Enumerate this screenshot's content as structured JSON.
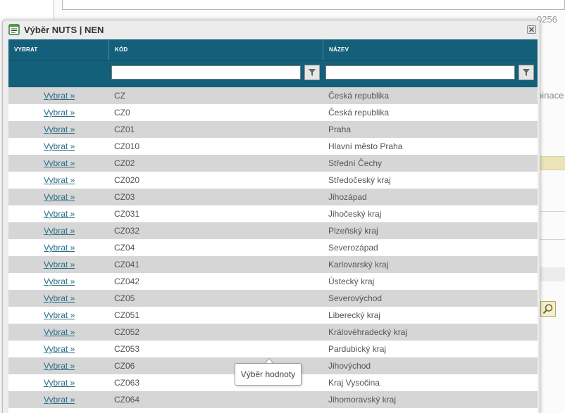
{
  "background": {
    "text_top": "0256",
    "text_side": "binace"
  },
  "dialog": {
    "title": "Výběr NUTS | NEN",
    "columns": [
      "VYBRAT",
      "KÓD",
      "NÁZEV"
    ],
    "filters": {
      "code_value": "",
      "name_value": ""
    },
    "rows": [
      {
        "link": "Vybrat »",
        "code": "CZ",
        "name": "Česká republika"
      },
      {
        "link": "Vybrat »",
        "code": "CZ0",
        "name": "Česká republika"
      },
      {
        "link": "Vybrat »",
        "code": "CZ01",
        "name": "Praha"
      },
      {
        "link": "Vybrat »",
        "code": "CZ010",
        "name": "Hlavní město Praha"
      },
      {
        "link": "Vybrat »",
        "code": "CZ02",
        "name": "Střední Čechy"
      },
      {
        "link": "Vybrat »",
        "code": "CZ020",
        "name": "Středočeský kraj"
      },
      {
        "link": "Vybrat »",
        "code": "CZ03",
        "name": "Jihozápad"
      },
      {
        "link": "Vybrat »",
        "code": "CZ031",
        "name": "Jihočeský kraj"
      },
      {
        "link": "Vybrat »",
        "code": "CZ032",
        "name": "Plzeňský kraj"
      },
      {
        "link": "Vybrat »",
        "code": "CZ04",
        "name": "Severozápad"
      },
      {
        "link": "Vybrat »",
        "code": "CZ041",
        "name": "Karlovarský kraj"
      },
      {
        "link": "Vybrat »",
        "code": "CZ042",
        "name": "Ústecký kraj"
      },
      {
        "link": "Vybrat »",
        "code": "CZ05",
        "name": "Severovýchod"
      },
      {
        "link": "Vybrat »",
        "code": "CZ051",
        "name": "Liberecký kraj"
      },
      {
        "link": "Vybrat »",
        "code": "CZ052",
        "name": "Královéhradecký kraj"
      },
      {
        "link": "Vybrat »",
        "code": "CZ053",
        "name": "Pardubický kraj"
      },
      {
        "link": "Vybrat »",
        "code": "CZ06",
        "name": "Jihovýchod"
      },
      {
        "link": "Vybrat »",
        "code": "CZ063",
        "name": "Kraj Vysočina"
      },
      {
        "link": "Vybrat »",
        "code": "CZ064",
        "name": "Jihomoravský kraj"
      }
    ],
    "tooltip": "Výběr hodnoty"
  },
  "icons": {
    "title": "list-window-icon",
    "close": "close-icon",
    "filter": "filter-icon",
    "search": "search-icon"
  },
  "colors": {
    "header": "#145f7a",
    "link": "#2a6f88",
    "row_alt": "#d6d6d6"
  }
}
